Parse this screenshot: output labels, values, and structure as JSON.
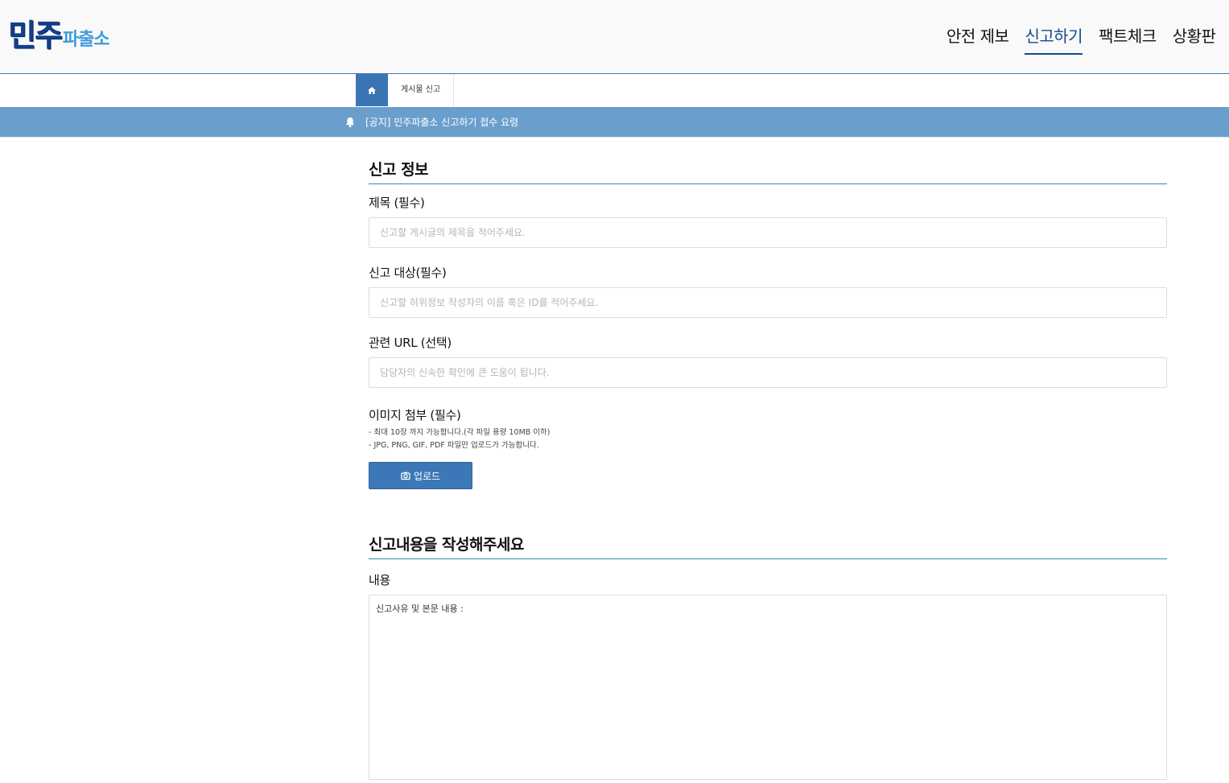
{
  "header": {
    "logo_main": "민주",
    "logo_sub": "파출소",
    "nav": [
      {
        "label": "안전 제보",
        "active": false
      },
      {
        "label": "신고하기",
        "active": true
      },
      {
        "label": "팩트체크",
        "active": false
      },
      {
        "label": "상황판",
        "active": false
      }
    ]
  },
  "breadcrumb": {
    "home_icon": "home-icon",
    "current": "게시물 신고"
  },
  "notice": {
    "icon": "bell-icon",
    "text": "[공지] 민주파출소 신고하기 접수 요령"
  },
  "form": {
    "section1_title": "신고 정보",
    "title_field": {
      "label": "제목 (필수)",
      "placeholder": "신고할 게시글의 제목을 적어주세요.",
      "value": ""
    },
    "target_field": {
      "label": "신고 대상(필수)",
      "placeholder": "신고할 허위정보 작성자의 이름 혹은 ID를 적어주세요.",
      "value": ""
    },
    "url_field": {
      "label": "관련 URL (선택)",
      "placeholder": "담당자의 신속한 확인에 큰 도움이 됩니다.",
      "value": ""
    },
    "image_section": {
      "label": "이미지 첨부 (필수)",
      "hint1": "- 최대 10장 까지 가능합니다.(각 파일 용량 10MB 이하)",
      "hint2": "- JPG, PNG, GIF, PDF 파일만 업로드가 가능합니다.",
      "upload_label": "업로드",
      "upload_icon": "camera-icon"
    },
    "section2_title": "신고내용을 작성해주세요",
    "content_field": {
      "label": "내용",
      "value": "신고사유 및 본문 내용 :"
    }
  },
  "colors": {
    "accent": "#3a74b4",
    "notice_bar": "#6a9fcd",
    "nav_active": "#15498c"
  }
}
